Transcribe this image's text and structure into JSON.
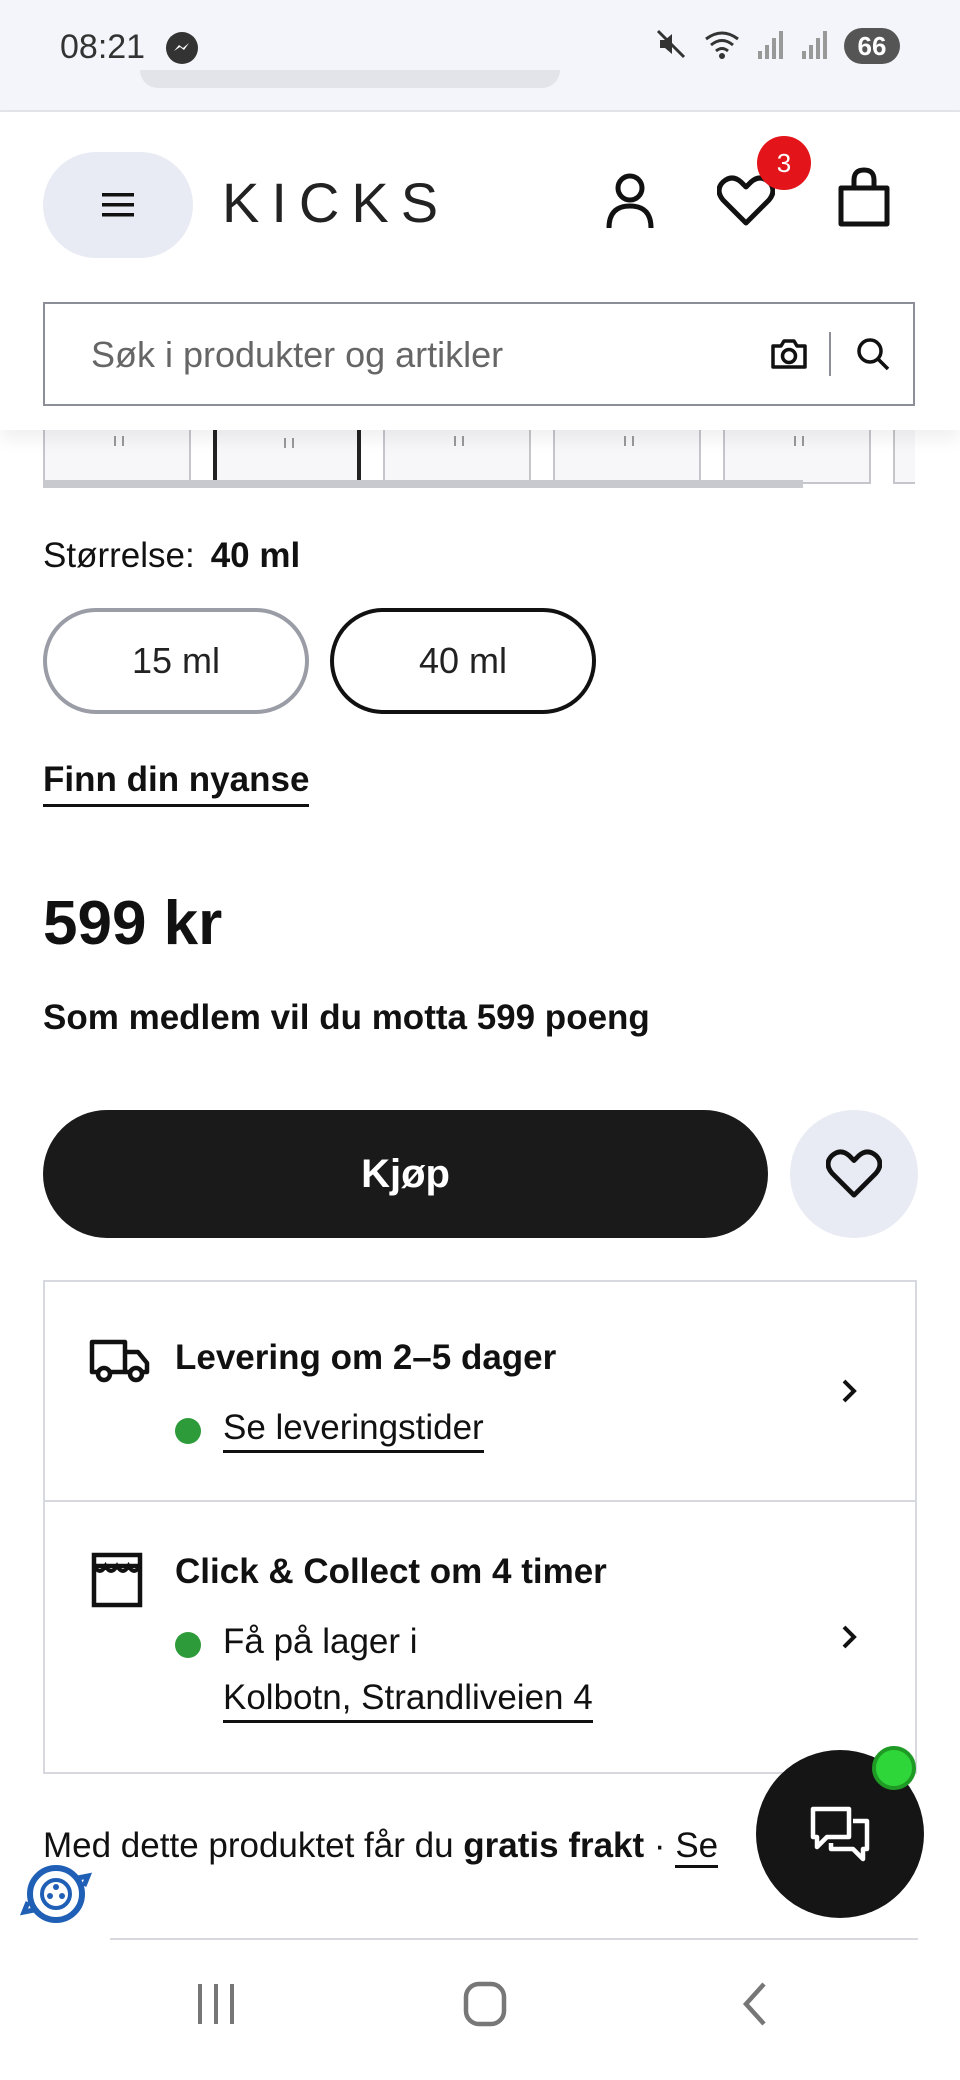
{
  "status_bar": {
    "time": "08:21",
    "battery": "66"
  },
  "header": {
    "logo": "KICKS",
    "wishlist_count": "3",
    "search_placeholder": "Søk i produkter og artikler"
  },
  "product": {
    "size_label": "Størrelse:",
    "size_selected": "40 ml",
    "size_options": [
      "15 ml",
      "40 ml"
    ],
    "find_shade": "Finn din nyanse",
    "price": "599 kr",
    "points_text": "Som medlem vil du motta 599 poeng",
    "buy_label": "Kjøp"
  },
  "delivery": {
    "title": "Levering om 2–5 dager",
    "link": "Se leveringstider"
  },
  "click_collect": {
    "title": "Click & Collect om 4 timer",
    "stock_text": "Få på lager i",
    "store_link": "Kolbotn, Strandliveien 4"
  },
  "footer_note": {
    "prefix": "Med dette produktet får du",
    "bold": "gratis frakt",
    "separator": "·",
    "link": "Se"
  },
  "colors": {
    "accent_dark": "#1a1a1a",
    "badge_red": "#e3151b",
    "stock_green": "#2e9b3a",
    "chip_bg": "#e8ebf3"
  }
}
